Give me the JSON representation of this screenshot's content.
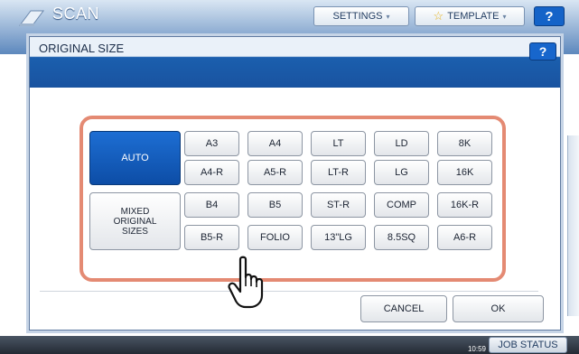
{
  "app": {
    "title": "SCAN"
  },
  "topbar": {
    "settings_label": "SETTINGS",
    "template_label": "TEMPLATE",
    "help_label": "?"
  },
  "dialog": {
    "title": "ORIGINAL SIZE",
    "help_label": "?",
    "auto_label": "AUTO",
    "mixed_label": "MIXED\nORIGINAL\nSIZES",
    "sizes": [
      [
        "A3",
        "A4",
        "LT",
        "LD",
        "8K"
      ],
      [
        "A4-R",
        "A5-R",
        "LT-R",
        "LG",
        "16K"
      ],
      [
        "B4",
        "B5",
        "ST-R",
        "COMP",
        "16K-R"
      ],
      [
        "B5-R",
        "FOLIO",
        "13\"LG",
        "8.5SQ",
        "A6-R"
      ]
    ],
    "cancel_label": "CANCEL",
    "ok_label": "OK"
  },
  "statusbar": {
    "time": "10:59",
    "job_status_label": "JOB STATUS"
  },
  "colors": {
    "accent": "#1b5fae",
    "highlight_border": "#e48a73"
  }
}
